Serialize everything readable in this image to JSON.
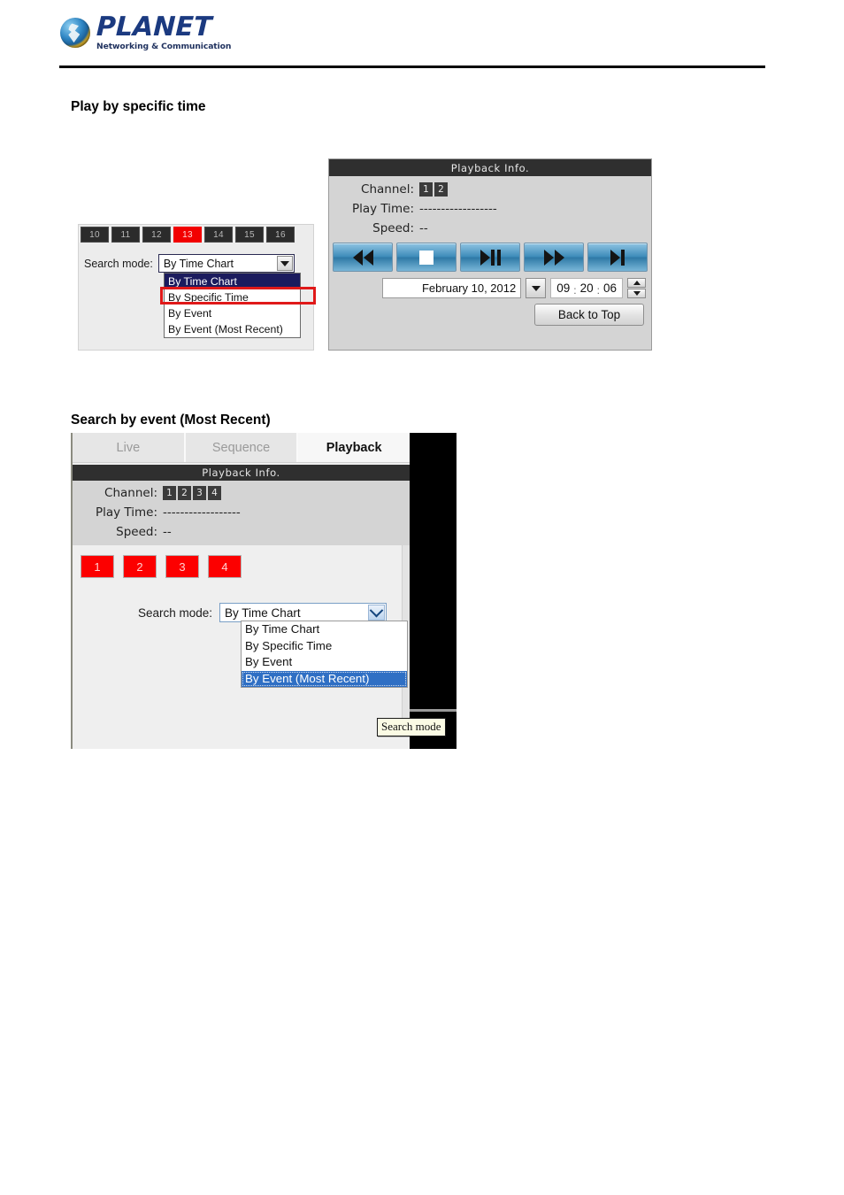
{
  "header": {
    "brand": "PLANET",
    "tagline": "Networking & Communication",
    "logo_icon": "planet-globe-logo"
  },
  "sections": [
    {
      "id": "play-specific",
      "title": "Play by specific time"
    },
    {
      "id": "search-event",
      "title": "Search by event (Most Recent)"
    }
  ],
  "figure1": {
    "timeline": {
      "cells": [
        "10",
        "11",
        "12",
        "13",
        "14",
        "15",
        "16"
      ],
      "active": "13",
      "active_color": "#f20000"
    },
    "search_mode": {
      "label": "Search mode:",
      "value": "By Time Chart",
      "options": [
        "By Time Chart",
        "By Specific Time",
        "By Event",
        "By Event (Most Recent)"
      ],
      "highlighted_option": "By Time Chart",
      "annotated_option": "By Specific Time",
      "annotation_color": "#e01919",
      "dropdown_icon": "chevron-down-icon"
    },
    "playback": {
      "panel_title": "Playback Info.",
      "channel_label": "Channel:",
      "channels": [
        "1",
        "2"
      ],
      "play_time_label": "Play Time:",
      "play_time_value": "------------------",
      "speed_label": "Speed:",
      "speed_value": "--",
      "transport": [
        {
          "name": "rewind-button",
          "icon": "rewind-icon"
        },
        {
          "name": "stop-button",
          "icon": "stop-icon"
        },
        {
          "name": "play-pause-button",
          "icon": "play-pause-icon"
        },
        {
          "name": "fast-forward-button",
          "icon": "fast-forward-icon"
        },
        {
          "name": "next-frame-button",
          "icon": "next-frame-icon"
        }
      ],
      "date_value": "February 10, 2012",
      "time_hours": "09",
      "time_minutes": "20",
      "time_seconds": "06",
      "time_separator": ":",
      "back_to_top_label": "Back to Top"
    }
  },
  "figure2": {
    "tabs": [
      {
        "label": "Live",
        "active": false
      },
      {
        "label": "Sequence",
        "active": false
      },
      {
        "label": "Playback",
        "active": true
      }
    ],
    "playback": {
      "panel_title": "Playback Info.",
      "channel_label": "Channel:",
      "channels": [
        "1",
        "2",
        "3",
        "4"
      ],
      "play_time_label": "Play Time:",
      "play_time_value": "------------------",
      "speed_label": "Speed:",
      "speed_value": "--"
    },
    "channel_buttons": [
      "1",
      "2",
      "3",
      "4"
    ],
    "channel_button_color": "#fc0000",
    "search_mode": {
      "label": "Search mode:",
      "value": "By Time Chart",
      "options": [
        "By Time Chart",
        "By Specific Time",
        "By Event",
        "By Event (Most Recent)"
      ],
      "selected_option": "By Event (Most Recent)",
      "selected_color": "#2f6fc4",
      "dropdown_icon": "chevron-down-icon"
    },
    "tooltip": "Search mode"
  }
}
